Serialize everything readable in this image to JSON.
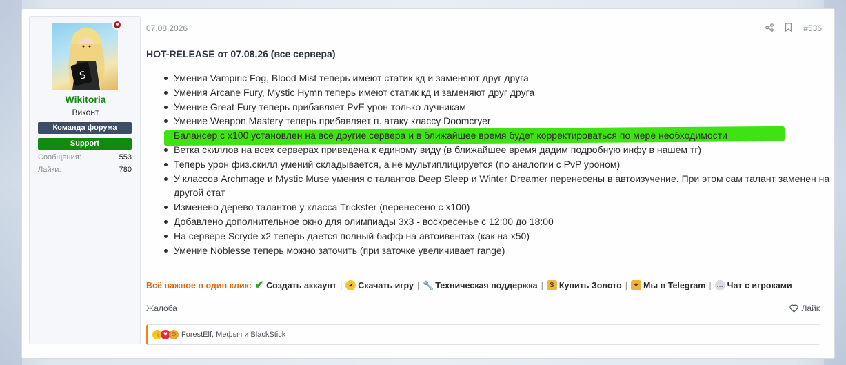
{
  "colors": {
    "username": "#0d8a0d",
    "team_banner": "#3d4d66",
    "support_banner": "#128a12",
    "highlight": "#3fe212",
    "quick_links_lead": "#e06a10",
    "reaction_border": "#f08020"
  },
  "user": {
    "name": "Wikitoria",
    "title": "Виконт",
    "banners": [
      "Команда форума",
      "Support"
    ],
    "stats": [
      {
        "label": "Сообщения:",
        "value": "553"
      },
      {
        "label": "Лайки:",
        "value": "780"
      }
    ],
    "online_icon": "online-status-icon"
  },
  "post": {
    "date": "07.08.2026",
    "number": "#536",
    "share_icon": "share-icon",
    "bookmark_icon": "bookmark-icon",
    "title": "HOT-RELEASE от 07.08.26 (все сервера)",
    "changes": [
      "Умения Vampiric Fog, Blood Mist теперь имеют статик кд и заменяют друг друга",
      "Умения Arcane Fury, Mystic Hymn теперь имеют статик кд и заменяют друг друга",
      "Умение Great Fury теперь прибавляет PvE урон только лучникам",
      "Умение Weapon Mastery теперь прибавляет п. атаку классу Doomcryer",
      "Балансер с х100 установлен на все другие сервера и в ближайшее время будет корректироваться по мере необходимости",
      "Ветка скиллов на всех серверах приведена к единому виду (в ближайшее время дадим подробную инфу в нашем тг)",
      "Теперь урон физ.скилл умений складывается, а не мультиплицируется (по аналогии с PvP уроном)",
      "У классов Archmage и Mystic Muse умения с талантов Deep Sleep и Winter Dreamer перенесены в автоизучение. При этом сам талант заменен на другой стат",
      "Изменено дерево талантов у класса Trickster (перенесено с х100)",
      "Добавлено дополнительное окно для олимпиады 3х3 - воскресенье с 12:00 до 18:00",
      "На сервере Scryde x2 теперь дается полный бафф на автоивентах (как на х50)",
      "Умение Noblesse теперь можно заточить (при заточке увеличивает range)"
    ]
  },
  "quick_links": {
    "lead": "Всё важное в один клик:",
    "items": [
      {
        "label": "Создать аккаунт",
        "icon": "check-icon"
      },
      {
        "label": "Скачать игру",
        "icon": "sunglasses-icon"
      },
      {
        "label": "Техническая поддержка",
        "icon": "wrench-icon"
      },
      {
        "label": "Купить Золото",
        "icon": "money-bag-icon"
      },
      {
        "label": "Мы в Telegram",
        "icon": "party-popper-icon"
      },
      {
        "label": "Чат с игроками",
        "icon": "speech-bubble-icon"
      }
    ]
  },
  "footer": {
    "report": "Жалоба",
    "like": "Лайк",
    "reactions_text": "ForestElf, Мефыч и BlackStick"
  }
}
